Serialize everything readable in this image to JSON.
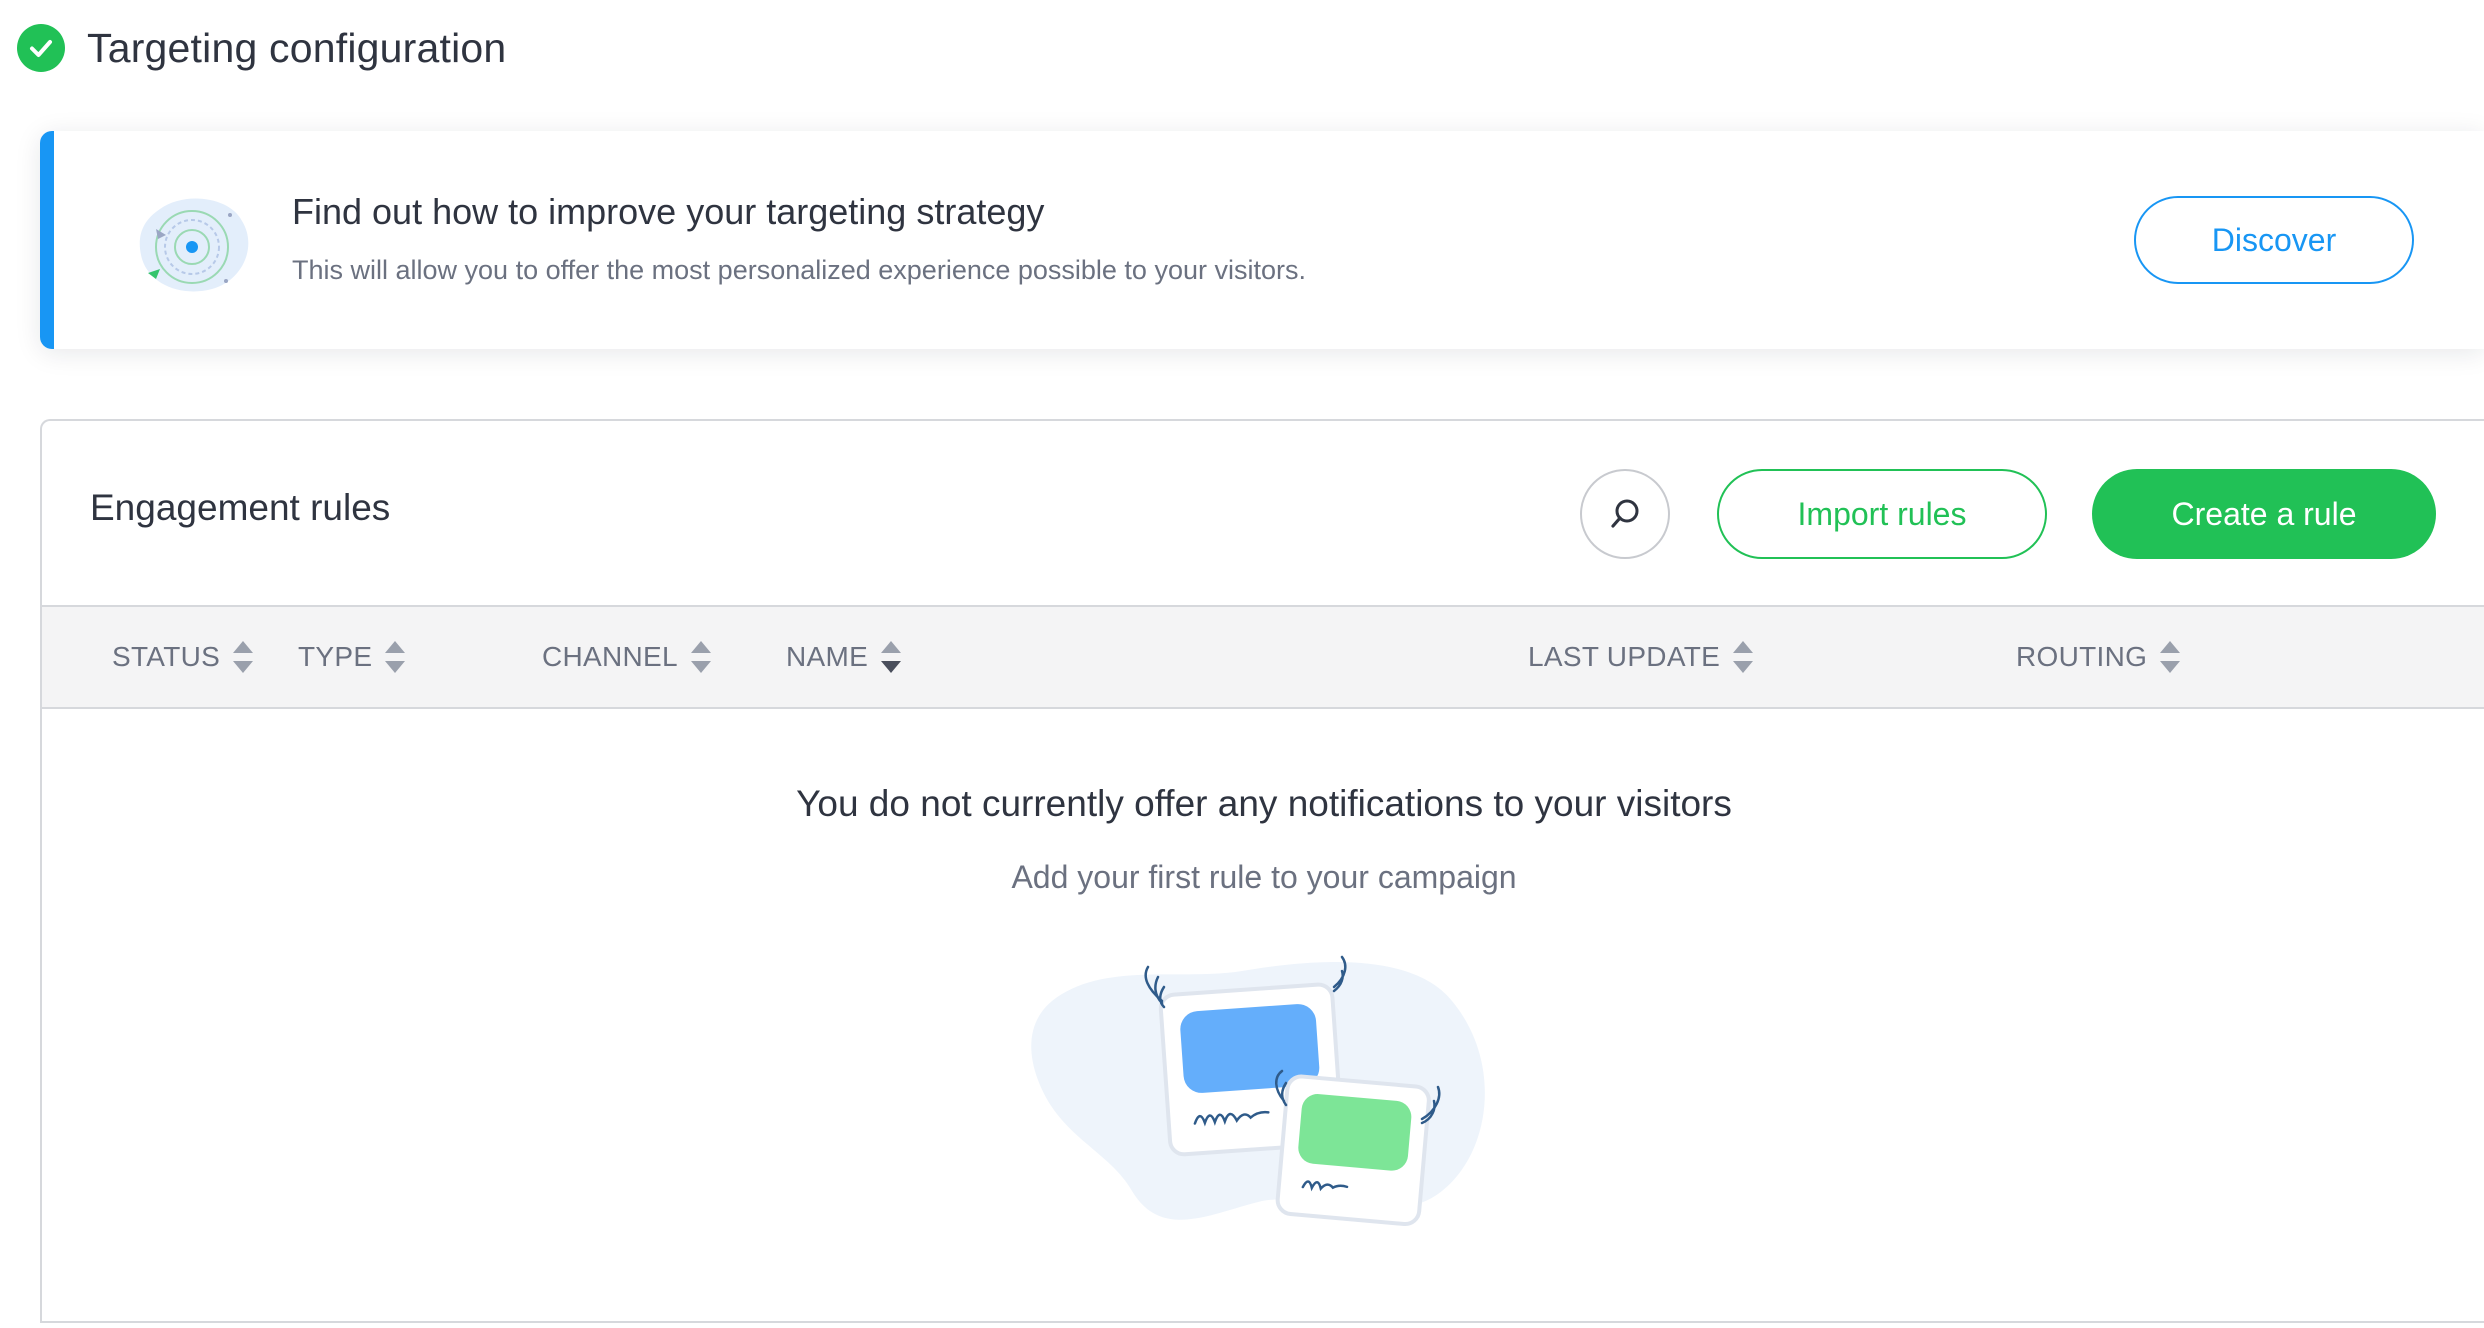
{
  "header": {
    "title": "Targeting configuration",
    "status_icon": "check-circle-icon",
    "status_color": "#21c156"
  },
  "banner": {
    "title": "Find out how to improve your targeting strategy",
    "subtitle": "This will allow you to offer the most personalized experience possible to your visitors.",
    "button_label": "Discover",
    "accent_color": "#1896f4",
    "illustration": "target-illustration"
  },
  "rules": {
    "title": "Engagement rules",
    "search_icon": "search-icon",
    "import_label": "Import rules",
    "create_label": "Create a rule",
    "columns": [
      {
        "label": "STATUS",
        "sort": "none"
      },
      {
        "label": "TYPE",
        "sort": "none"
      },
      {
        "label": "CHANNEL",
        "sort": "none"
      },
      {
        "label": "NAME",
        "sort": "descending"
      },
      {
        "label": "LAST UPDATE",
        "sort": "none"
      },
      {
        "label": "ROUTING",
        "sort": "none"
      }
    ],
    "empty_state": {
      "title": "You do not currently offer any notifications to your visitors",
      "subtitle": "Add your first rule to your campaign",
      "illustration": "flying-messages-illustration"
    }
  },
  "colors": {
    "primary_green": "#21c156",
    "primary_blue": "#1896f4",
    "text_dark": "#2f3440",
    "text_muted": "#6b7180"
  }
}
